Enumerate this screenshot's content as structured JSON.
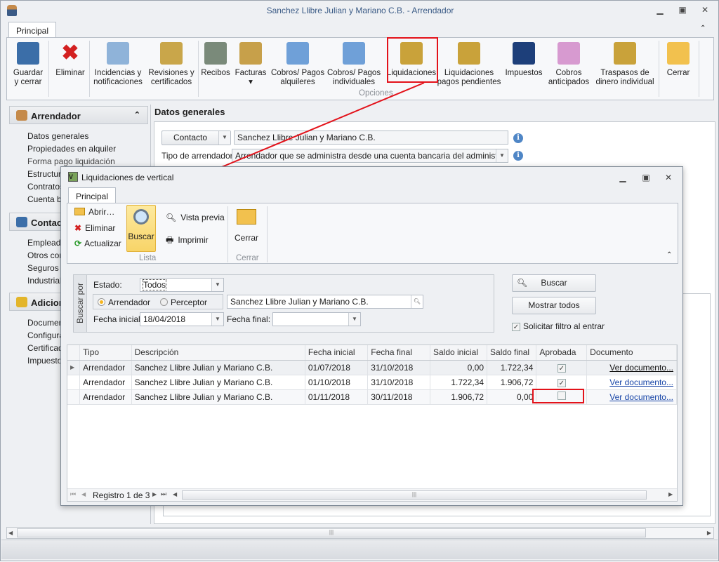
{
  "window": {
    "title": "Sanchez Llibre Julian y Mariano C.B. - Arrendador",
    "tab": "Principal"
  },
  "ribbon": {
    "buttons": [
      {
        "label": "Guardar\ny cerrar"
      },
      {
        "label": "Eliminar"
      },
      {
        "label": "Incidencias y\nnotificaciones"
      },
      {
        "label": "Revisiones y\ncertificados"
      },
      {
        "label": "Recibos"
      },
      {
        "label": "Facturas\n▾"
      },
      {
        "label": "Cobros/ Pagos\nalquileres"
      },
      {
        "label": "Cobros/ Pagos\nindividuales"
      },
      {
        "label": "Liquidaciones"
      },
      {
        "label": "Liquidaciones\npagos pendientes"
      },
      {
        "label": "Impuestos"
      },
      {
        "label": "Cobros\nanticipados"
      },
      {
        "label": "Traspasos de\ndinero individual"
      },
      {
        "label": "Cerrar"
      }
    ],
    "group": "Opciones"
  },
  "sidebar": {
    "groups": [
      {
        "title": "Arrendador",
        "items": [
          "Datos generales",
          "Propiedades en alquiler",
          "Forma pago liquidación",
          "Estructura",
          "Contratos",
          "Cuenta ba"
        ]
      },
      {
        "title": "Contactos",
        "items": [
          "Empleados",
          "Otros con",
          "Seguros y",
          "Industriale"
        ]
      },
      {
        "title": "Adicional",
        "items": [
          "Document",
          "Configura",
          "Certificad",
          "Impuestos"
        ]
      }
    ]
  },
  "main": {
    "header": "Datos generales",
    "contact_button": "Contacto",
    "contact_value": "Sanchez Llibre Julian y Mariano C.B.",
    "tipo_label": "Tipo de arrendador:",
    "tipo_value": "Arrendador que se administra desde una cuenta bancaria del administrador"
  },
  "dialog": {
    "title": "Liquidaciones de vertical",
    "tab": "Principal",
    "ribbon": {
      "abrir": "Abrir…",
      "eliminar": "Eliminar",
      "actualizar": "Actualizar",
      "buscar": "Buscar",
      "vista_previa": "Vista previa",
      "imprimir": "Imprimir",
      "cerrar": "Cerrar",
      "group_lista": "Lista",
      "group_cerrar": "Cerrar"
    },
    "filter": {
      "group_label": "Buscar por",
      "estado_label": "Estado:",
      "estado_value": "Todos",
      "radio_arrendador": "Arrendador",
      "radio_perceptor": "Perceptor",
      "radio_selected": "Arrendador",
      "persona_value": "Sanchez Llibre Julian y Mariano C.B.",
      "fecha_inicial_label": "Fecha inicial:",
      "fecha_inicial_value": "18/04/2018",
      "fecha_final_label": "Fecha final:",
      "fecha_final_value": "",
      "buscar_button": "Buscar",
      "mostrar_todos_button": "Mostrar todos",
      "solicitar_label": "Solicitar filtro al entrar",
      "solicitar_checked": true
    },
    "grid": {
      "columns": [
        "Tipo",
        "Descripción",
        "Fecha inicial",
        "Fecha final",
        "Saldo inicial",
        "Saldo final",
        "Aprobada",
        "Documento"
      ],
      "rows": [
        {
          "tipo": "Arrendador",
          "descripcion": "Sanchez Llibre Julian y Mariano C.B.",
          "fecha_inicial": "01/07/2018",
          "fecha_final": "31/10/2018",
          "saldo_inicial": "0,00",
          "saldo_final": "1.722,34",
          "aprobada": true,
          "documento": "Ver documento..."
        },
        {
          "tipo": "Arrendador",
          "descripcion": "Sanchez Llibre Julian y Mariano C.B.",
          "fecha_inicial": "01/10/2018",
          "fecha_final": "31/10/2018",
          "saldo_inicial": "1.722,34",
          "saldo_final": "1.906,72",
          "aprobada": true,
          "documento": "Ver documento..."
        },
        {
          "tipo": "Arrendador",
          "descripcion": "Sanchez Llibre Julian y Mariano C.B.",
          "fecha_inicial": "01/11/2018",
          "fecha_final": "30/11/2018",
          "saldo_inicial": "1.906,72",
          "saldo_final": "0,00",
          "aprobada": false,
          "documento": "Ver documento..."
        }
      ]
    },
    "navigator": "Registro 1 de 3"
  }
}
